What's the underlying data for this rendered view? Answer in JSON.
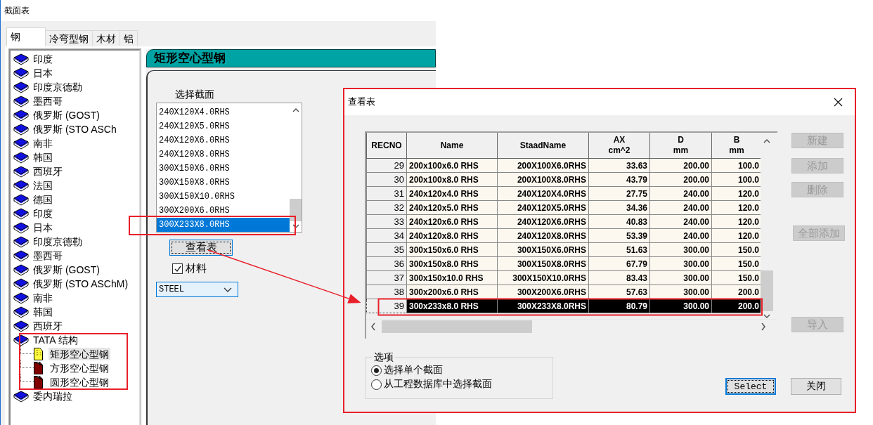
{
  "window": {
    "title": "截面表"
  },
  "tabs": [
    {
      "label": "钢",
      "selected": true
    },
    {
      "label": "冷弯型钢",
      "selected": false
    },
    {
      "label": "木材",
      "selected": false
    },
    {
      "label": "铝",
      "selected": false
    }
  ],
  "tree": [
    {
      "label": "印度",
      "kind": "book"
    },
    {
      "label": "日本",
      "kind": "book"
    },
    {
      "label": "印度京德勒",
      "kind": "book"
    },
    {
      "label": "墨西哥",
      "kind": "book"
    },
    {
      "label": "俄罗斯 (GOST)",
      "kind": "book"
    },
    {
      "label": "俄罗斯 (STO ASCh",
      "kind": "book"
    },
    {
      "label": "南非",
      "kind": "book"
    },
    {
      "label": "韩国",
      "kind": "book"
    },
    {
      "label": "西班牙",
      "kind": "book"
    },
    {
      "label": "法国",
      "kind": "book"
    },
    {
      "label": "德国",
      "kind": "book"
    },
    {
      "label": "印度",
      "kind": "book"
    },
    {
      "label": "日本",
      "kind": "book"
    },
    {
      "label": "印度京德勒",
      "kind": "book"
    },
    {
      "label": "墨西哥",
      "kind": "book"
    },
    {
      "label": "俄罗斯 (GOST)",
      "kind": "book"
    },
    {
      "label": "俄罗斯 (STO ASChM)",
      "kind": "book"
    },
    {
      "label": "南非",
      "kind": "book"
    },
    {
      "label": "韩国",
      "kind": "book"
    },
    {
      "label": "西班牙",
      "kind": "book"
    },
    {
      "label": "TATA 结构",
      "kind": "book",
      "expanded": true,
      "children": [
        {
          "label": "矩形空心型钢",
          "kind": "page",
          "selected": true
        },
        {
          "label": "方形空心型钢",
          "kind": "page",
          "selected": false
        },
        {
          "label": "圆形空心型钢",
          "kind": "page",
          "selected": false
        }
      ]
    },
    {
      "label": "委内瑞拉",
      "kind": "book"
    }
  ],
  "panel": {
    "header": "矩形空心型钢",
    "list_label": "选择截面",
    "sections": [
      {
        "label": "240X120X4.0RHS",
        "selected": false
      },
      {
        "label": "240X120X5.0RHS",
        "selected": false
      },
      {
        "label": "240X120X6.0RHS",
        "selected": false
      },
      {
        "label": "240X120X8.0RHS",
        "selected": false
      },
      {
        "label": "300X150X6.0RHS",
        "selected": false
      },
      {
        "label": "300X150X8.0RHS",
        "selected": false
      },
      {
        "label": "300X150X10.0RHS",
        "selected": false
      },
      {
        "label": "300X200X6.0RHS",
        "selected": false
      },
      {
        "label": "300X233X8.0RHS",
        "selected": true
      }
    ],
    "view_button": "查看表",
    "material_checkbox": {
      "label": "材料",
      "checked": true
    },
    "material_dropdown": {
      "value": "STEEL"
    }
  },
  "dialog": {
    "title": "查看表",
    "table": {
      "columns": [
        {
          "label": "RECNO"
        },
        {
          "label": "Name"
        },
        {
          "label": "StaadName"
        },
        {
          "label": "AX",
          "unit": "cm^2"
        },
        {
          "label": "D",
          "unit": "mm"
        },
        {
          "label": "B",
          "unit": "mm"
        }
      ],
      "rows": [
        {
          "selected": false,
          "cells": [
            "29",
            "200x100x6.0 RHS",
            "200X100X6.0RHS",
            "33.63",
            "200.00",
            "100.0"
          ]
        },
        {
          "selected": false,
          "cells": [
            "30",
            "200x100x8.0 RHS",
            "200X100X8.0RHS",
            "43.79",
            "200.00",
            "100.0"
          ]
        },
        {
          "selected": false,
          "cells": [
            "31",
            "240x120x4.0 RHS",
            "240X120X4.0RHS",
            "27.75",
            "240.00",
            "120.0"
          ]
        },
        {
          "selected": false,
          "cells": [
            "32",
            "240x120x5.0 RHS",
            "240X120X5.0RHS",
            "34.36",
            "240.00",
            "120.0"
          ]
        },
        {
          "selected": false,
          "cells": [
            "33",
            "240x120x6.0 RHS",
            "240X120X6.0RHS",
            "40.83",
            "240.00",
            "120.0"
          ]
        },
        {
          "selected": false,
          "cells": [
            "34",
            "240x120x8.0 RHS",
            "240X120X8.0RHS",
            "53.39",
            "240.00",
            "120.0"
          ]
        },
        {
          "selected": false,
          "cells": [
            "35",
            "300x150x6.0 RHS",
            "300X150X6.0RHS",
            "51.63",
            "300.00",
            "150.0"
          ]
        },
        {
          "selected": false,
          "cells": [
            "36",
            "300x150x8.0 RHS",
            "300X150X8.0RHS",
            "67.79",
            "300.00",
            "150.0"
          ]
        },
        {
          "selected": false,
          "cells": [
            "37",
            "300x150x10.0 RHS",
            "300X150X10.0RHS",
            "83.43",
            "300.00",
            "150.0"
          ]
        },
        {
          "selected": false,
          "cells": [
            "38",
            "300x200x6.0 RHS",
            "300X200X6.0RHS",
            "57.63",
            "300.00",
            "200.0"
          ]
        },
        {
          "selected": true,
          "cells": [
            "39",
            "300x233x8.0 RHS",
            "300X233X8.0RHS",
            "80.79",
            "300.00",
            "200.0"
          ]
        }
      ]
    },
    "side_buttons": [
      {
        "label": "新建",
        "disabled": true
      },
      {
        "label": "添加",
        "disabled": true
      },
      {
        "label": "删除",
        "disabled": true
      },
      {
        "label": "全部添加",
        "disabled": true
      },
      {
        "label": "导入",
        "disabled": true
      }
    ],
    "options": {
      "title": "选项",
      "items": [
        {
          "label": "选择单个截面",
          "selected": true
        },
        {
          "label": "从工程数据库中选择截面",
          "selected": false
        }
      ]
    },
    "buttons": [
      {
        "label": "Select",
        "focused": true
      },
      {
        "label": "关闭",
        "focused": false
      }
    ]
  },
  "annotations": [
    {
      "kind": "box"
    },
    {
      "kind": "box"
    },
    {
      "kind": "box"
    },
    {
      "kind": "box"
    },
    {
      "kind": "arrow"
    }
  ]
}
